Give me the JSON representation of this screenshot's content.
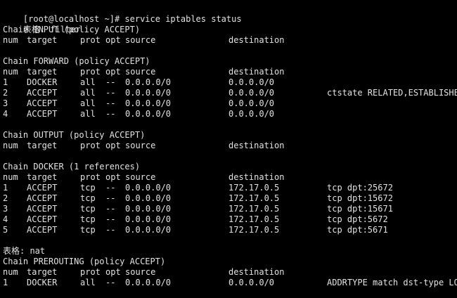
{
  "colors": {
    "background": "#000000",
    "foreground": "#e2e2e2"
  },
  "terminal": {
    "prompt": "[root@localhost ~]# service iptables status",
    "table_filter_label": "表格: filter",
    "input_chain": {
      "header": "Chain INPUT (policy ACCEPT)",
      "columns": [
        "num",
        "target",
        "prot",
        "opt",
        "source",
        "destination"
      ],
      "rows": []
    },
    "forward_chain": {
      "header": "Chain FORWARD (policy ACCEPT)",
      "columns": [
        "num",
        "target",
        "prot",
        "opt",
        "source",
        "destination"
      ],
      "rows": [
        {
          "num": "1",
          "target": "DOCKER",
          "prot": "all",
          "opt": "--",
          "source": "0.0.0.0/0",
          "destination": "0.0.0.0/0",
          "extra": ""
        },
        {
          "num": "2",
          "target": "ACCEPT",
          "prot": "all",
          "opt": "--",
          "source": "0.0.0.0/0",
          "destination": "0.0.0.0/0",
          "extra": "ctstate RELATED,ESTABLISHED"
        },
        {
          "num": "3",
          "target": "ACCEPT",
          "prot": "all",
          "opt": "--",
          "source": "0.0.0.0/0",
          "destination": "0.0.0.0/0",
          "extra": ""
        },
        {
          "num": "4",
          "target": "ACCEPT",
          "prot": "all",
          "opt": "--",
          "source": "0.0.0.0/0",
          "destination": "0.0.0.0/0",
          "extra": ""
        }
      ]
    },
    "output_chain": {
      "header": "Chain OUTPUT (policy ACCEPT)",
      "columns": [
        "num",
        "target",
        "prot",
        "opt",
        "source",
        "destination"
      ],
      "rows": []
    },
    "docker_chain": {
      "header": "Chain DOCKER (1 references)",
      "columns": [
        "num",
        "target",
        "prot",
        "opt",
        "source",
        "destination"
      ],
      "rows": [
        {
          "num": "1",
          "target": "ACCEPT",
          "prot": "tcp",
          "opt": "--",
          "source": "0.0.0.0/0",
          "destination": "172.17.0.5",
          "extra": "tcp dpt:25672"
        },
        {
          "num": "2",
          "target": "ACCEPT",
          "prot": "tcp",
          "opt": "--",
          "source": "0.0.0.0/0",
          "destination": "172.17.0.5",
          "extra": "tcp dpt:15672"
        },
        {
          "num": "3",
          "target": "ACCEPT",
          "prot": "tcp",
          "opt": "--",
          "source": "0.0.0.0/0",
          "destination": "172.17.0.5",
          "extra": "tcp dpt:15671"
        },
        {
          "num": "4",
          "target": "ACCEPT",
          "prot": "tcp",
          "opt": "--",
          "source": "0.0.0.0/0",
          "destination": "172.17.0.5",
          "extra": "tcp dpt:5672"
        },
        {
          "num": "5",
          "target": "ACCEPT",
          "prot": "tcp",
          "opt": "--",
          "source": "0.0.0.0/0",
          "destination": "172.17.0.5",
          "extra": "tcp dpt:5671"
        }
      ]
    },
    "table_nat_label": "表格: nat",
    "prerouting_chain": {
      "header": "Chain PREROUTING (policy ACCEPT)",
      "columns": [
        "num",
        "target",
        "prot",
        "opt",
        "source",
        "destination"
      ],
      "rows": [
        {
          "num": "1",
          "target": "DOCKER",
          "prot": "all",
          "opt": "--",
          "source": "0.0.0.0/0",
          "destination": "0.0.0.0/0",
          "extra": "ADDRTYPE match dst-type LOCAL"
        }
      ]
    }
  }
}
